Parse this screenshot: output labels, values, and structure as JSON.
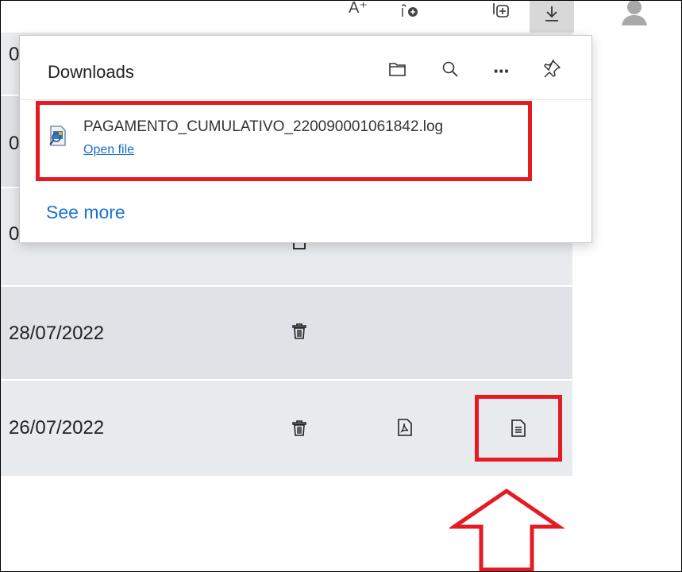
{
  "toolbar": {
    "read_aloud_glyph": "A⁺",
    "buttons": [
      "read-aloud",
      "favorites",
      "collections",
      "downloads",
      "profile"
    ]
  },
  "downloads_panel": {
    "title": "Downloads",
    "actions": [
      "open-folder",
      "search",
      "more-options",
      "pin"
    ],
    "more_glyph": "···",
    "items": [
      {
        "file_name": "PAGAMENTO_CUMULATIVO_220090001061842.log",
        "action_label": "Open file"
      }
    ],
    "see_more_label": "See more"
  },
  "table": {
    "rows": [
      {
        "date": "0",
        "partial": true,
        "icons": []
      },
      {
        "date": "0",
        "partial": true,
        "icons": []
      },
      {
        "date": "0",
        "partial": true,
        "icons": [
          "trash"
        ]
      },
      {
        "date": "28/07/2022",
        "icons": [
          "trash"
        ]
      },
      {
        "date": "26/07/2022",
        "icons": [
          "trash",
          "pdf",
          "document"
        ]
      }
    ]
  },
  "annotations": {
    "highlight_color": "#e51b23",
    "arrow_direction": "up"
  },
  "colors": {
    "row_even": "#e8ebee",
    "row_odd": "#dfe3e7",
    "link": "#1a6fc9",
    "active_button": "#d8d8d8"
  }
}
